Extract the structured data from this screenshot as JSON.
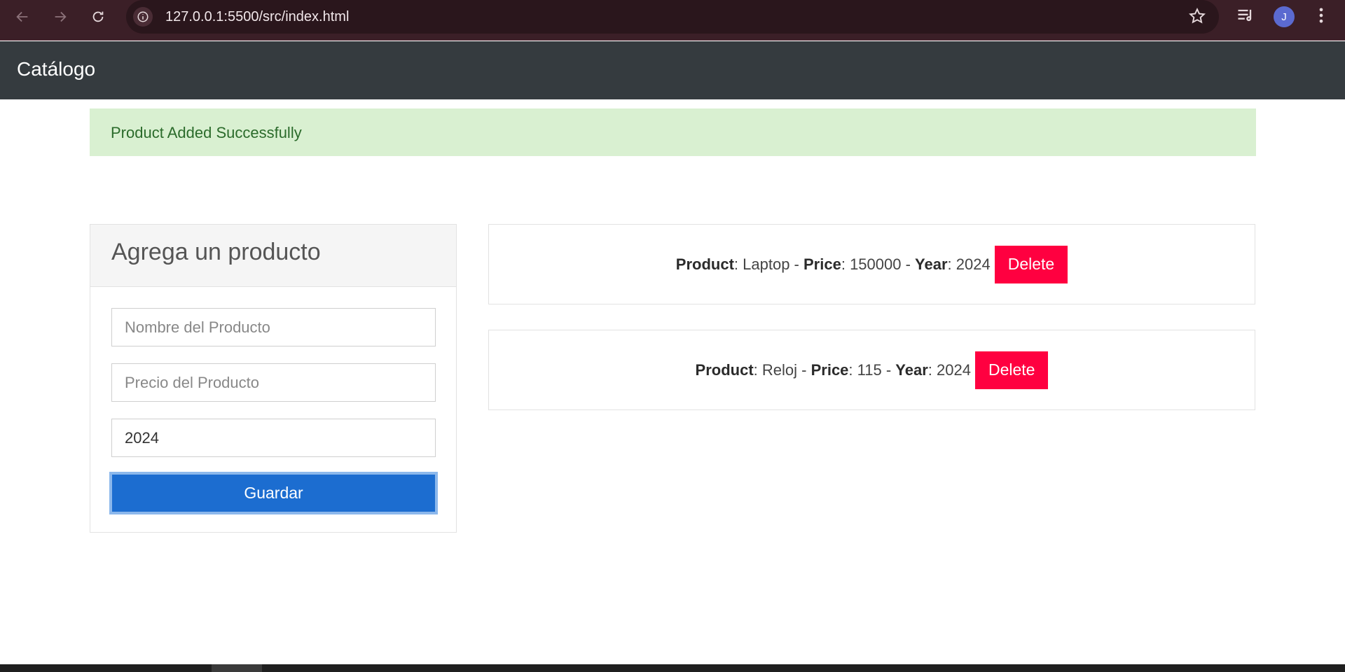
{
  "browser": {
    "url": "127.0.0.1:5500/src/index.html",
    "avatar_letter": "J"
  },
  "navbar": {
    "brand": "Catálogo"
  },
  "alert": {
    "message": "Product Added Successfully",
    "color": "#d9f0d1"
  },
  "form": {
    "title": "Agrega un producto",
    "name_placeholder": "Nombre del Producto",
    "price_placeholder": "Precio del Producto",
    "year_value": "2024",
    "submit_label": "Guardar"
  },
  "products": [
    {
      "product_label": "Product",
      "product": "Laptop",
      "price_label": "Price",
      "price": "150000",
      "year_label": "Year",
      "year": "2024",
      "delete_label": "Delete"
    },
    {
      "product_label": "Product",
      "product": "Reloj",
      "price_label": "Price",
      "price": "115",
      "year_label": "Year",
      "year": "2024",
      "delete_label": "Delete"
    }
  ],
  "colors": {
    "navbar": "#353b3f",
    "primary": "#1c6dd0",
    "danger": "#ff0040"
  }
}
